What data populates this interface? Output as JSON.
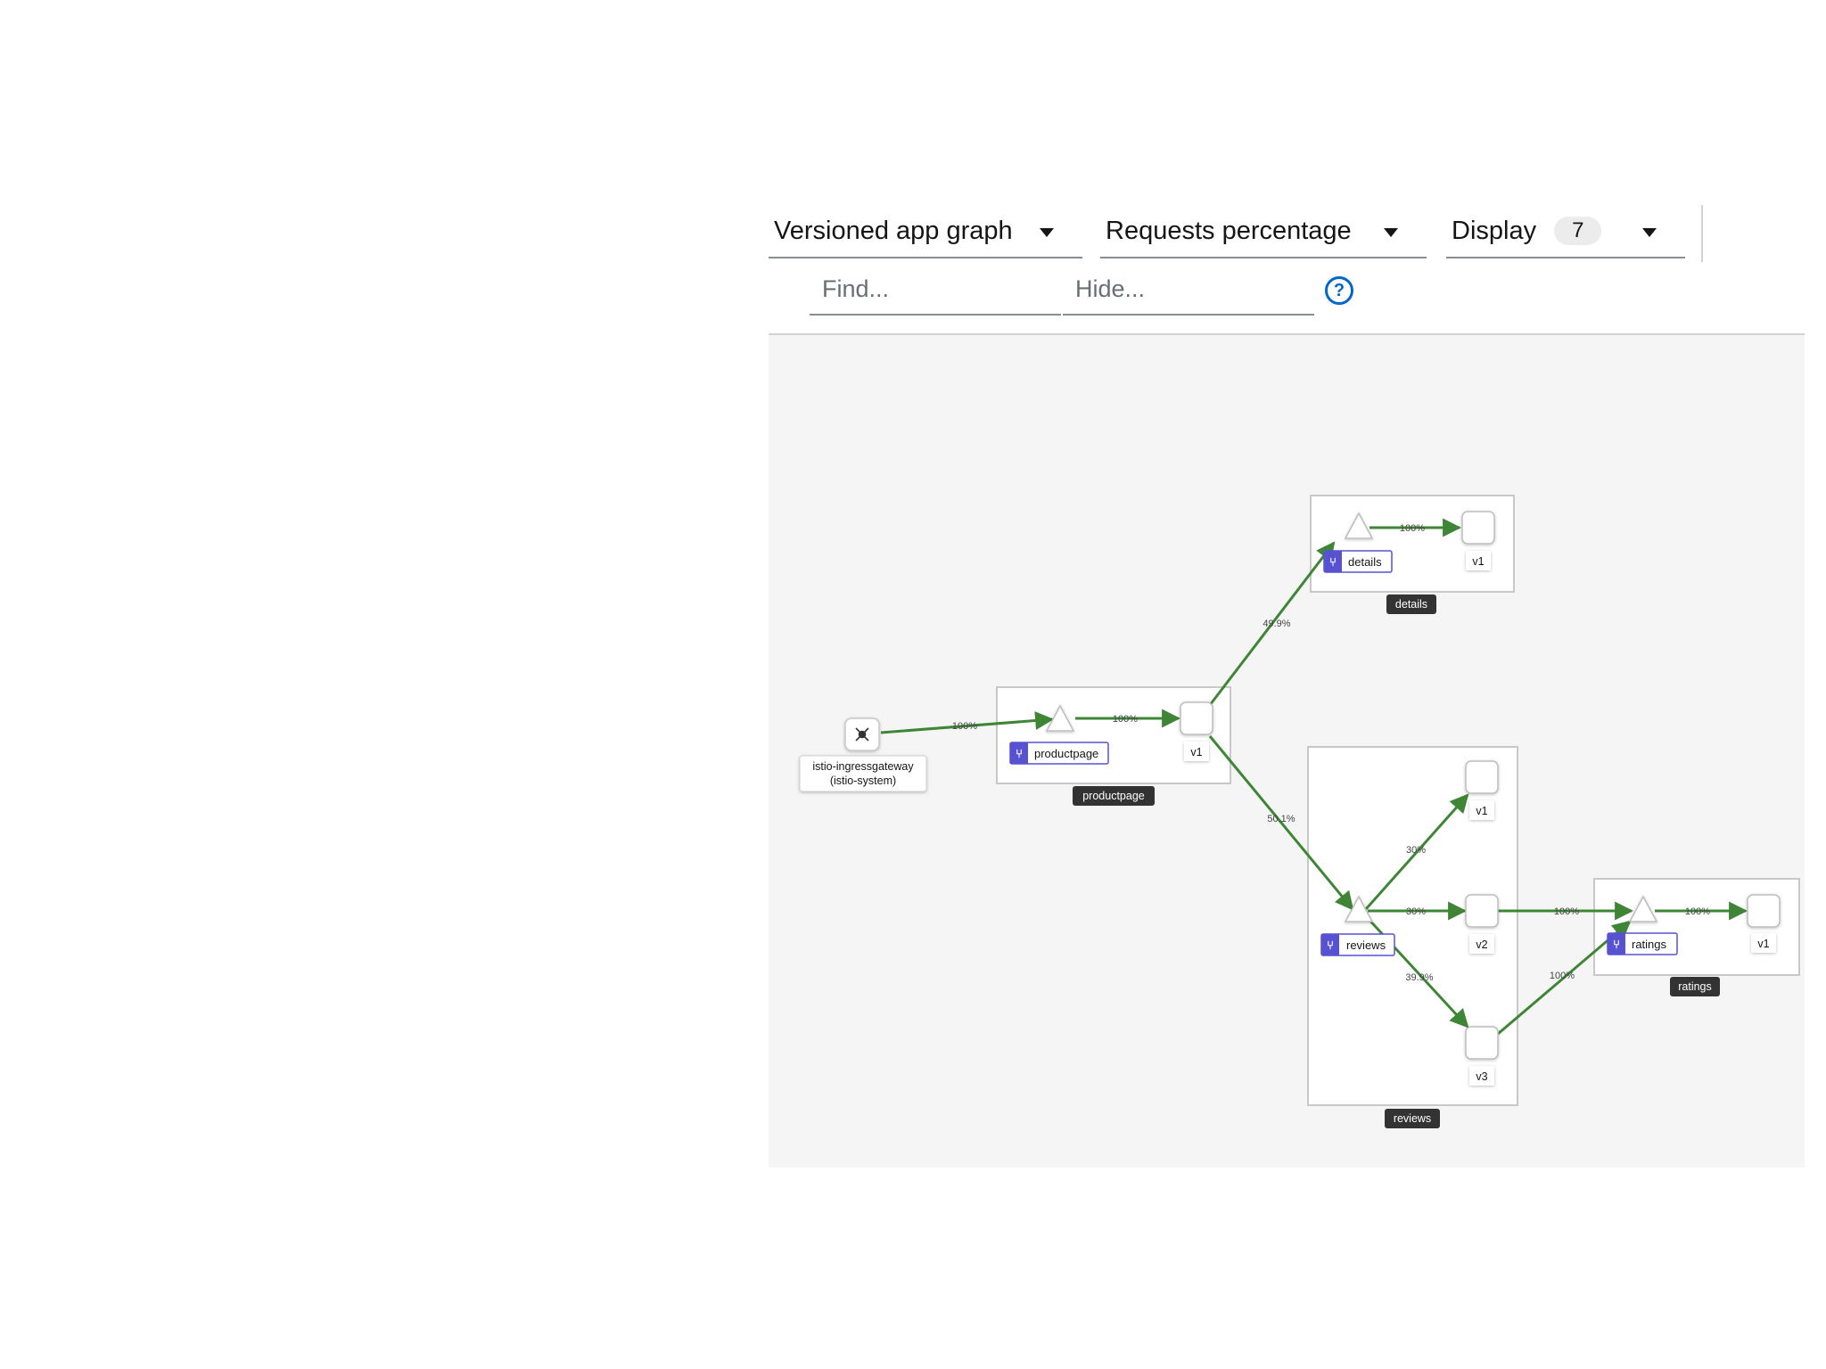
{
  "toolbar": {
    "graph_type": "Versioned app graph",
    "edge_labels": "Requests percentage",
    "display_label": "Display",
    "display_count": "7",
    "find_placeholder": "Find...",
    "hide_placeholder": "Hide...",
    "help_glyph": "?"
  },
  "colors": {
    "edge": "#3e8635",
    "service_badge": "#5752d1",
    "box_label_bg": "#333333"
  },
  "graph": {
    "gateway": {
      "label_line1": "istio-ingressgateway",
      "label_line2": "(istio-system)",
      "icon": "gateway-icon"
    },
    "productpage": {
      "box_label": "productpage",
      "service_label": "productpage",
      "version_label": "v1"
    },
    "details": {
      "box_label": "details",
      "service_label": "details",
      "version_label": "v1"
    },
    "reviews": {
      "box_label": "reviews",
      "service_label": "reviews",
      "v1_label": "v1",
      "v2_label": "v2",
      "v3_label": "v3"
    },
    "ratings": {
      "box_label": "ratings",
      "service_label": "ratings",
      "version_label": "v1"
    },
    "edges": {
      "gateway_to_productpage": "100%",
      "productpage_svc_to_v1": "100%",
      "productpage_to_details": "49.9%",
      "productpage_to_reviews": "50.1%",
      "details_svc_to_v1": "100%",
      "reviews_to_v1": "30%",
      "reviews_to_v2": "30%",
      "reviews_to_v3": "39.9%",
      "v2_to_ratings": "100%",
      "v3_to_ratings": "100%",
      "ratings_svc_to_v1": "100%"
    }
  }
}
